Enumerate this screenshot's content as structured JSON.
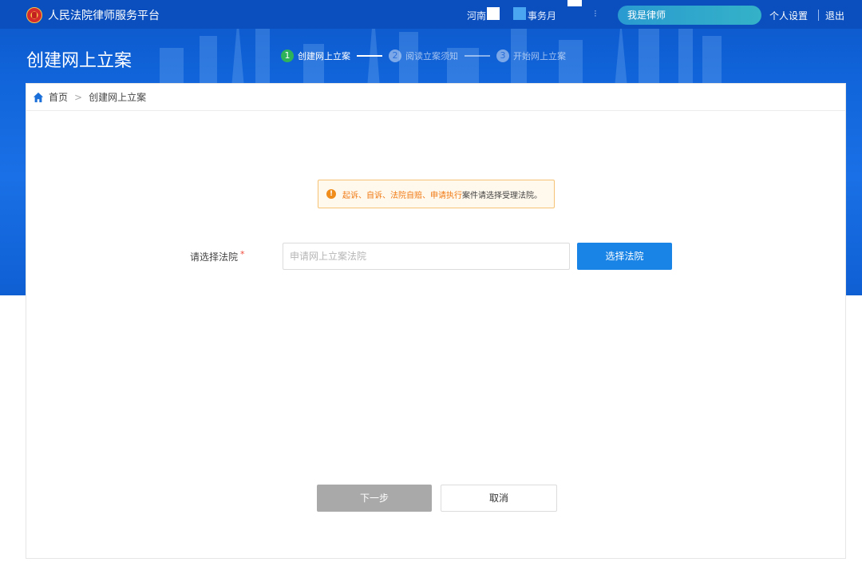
{
  "header": {
    "site_title": "人民法院律师服务平台",
    "region_label": "河南",
    "office_label": "事务月",
    "role_pill": "我是律师",
    "personal_settings": "个人设置",
    "logout": "退出"
  },
  "page": {
    "title": "创建网上立案"
  },
  "steps": [
    {
      "number": "1",
      "label": "创建网上立案",
      "state": "active"
    },
    {
      "number": "2",
      "label": "阅读立案须知",
      "state": "inactive"
    },
    {
      "number": "3",
      "label": "开始网上立案",
      "state": "inactive"
    }
  ],
  "breadcrumb": {
    "home": "首页",
    "current": "创建网上立案"
  },
  "notice": {
    "highlight": "起诉、自诉、法院自赔、申请执行",
    "rest": "案件请选择受理法院。"
  },
  "form": {
    "court_label": "请选择法院",
    "required_mark": "*",
    "court_placeholder": "申请网上立案法院",
    "court_value": "",
    "select_court_button": "选择法院"
  },
  "actions": {
    "next": "下一步",
    "cancel": "取消"
  },
  "colors": {
    "header_blue": "#1266dc",
    "primary_button": "#1a84e6",
    "disabled_button": "#a9a9a9",
    "notice_orange": "#f07a14",
    "step_active": "#2fb35a",
    "role_pill": "#2a9ad0"
  }
}
